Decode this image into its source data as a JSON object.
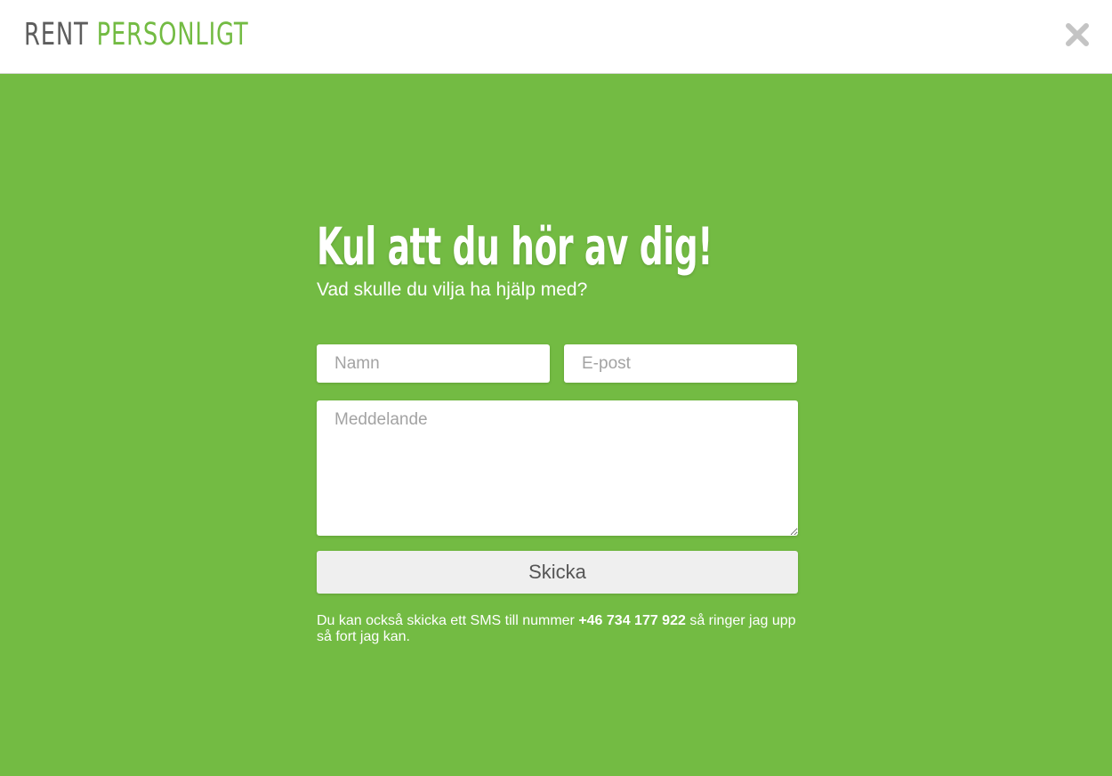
{
  "header": {
    "logo_part1": "RENT",
    "logo_part2": "PERSONLIGT",
    "close_icon": "close-icon"
  },
  "contact": {
    "title": "Kul att du hör av dig!",
    "subtitle": "Vad skulle du vilja ha hjälp med?",
    "name_placeholder": "Namn",
    "email_placeholder": "E-post",
    "message_placeholder": "Meddelande",
    "submit_label": "Skicka",
    "note_before": "Du kan också skicka ett SMS till nummer ",
    "note_phone": "+46 734 177 922",
    "note_after": " så ringer jag upp så fort jag kan."
  },
  "colors": {
    "brand_green": "#73bb43",
    "logo_gray": "#5d5d5d",
    "button_bg": "#efefef",
    "close_icon": "#c4c4c4"
  }
}
